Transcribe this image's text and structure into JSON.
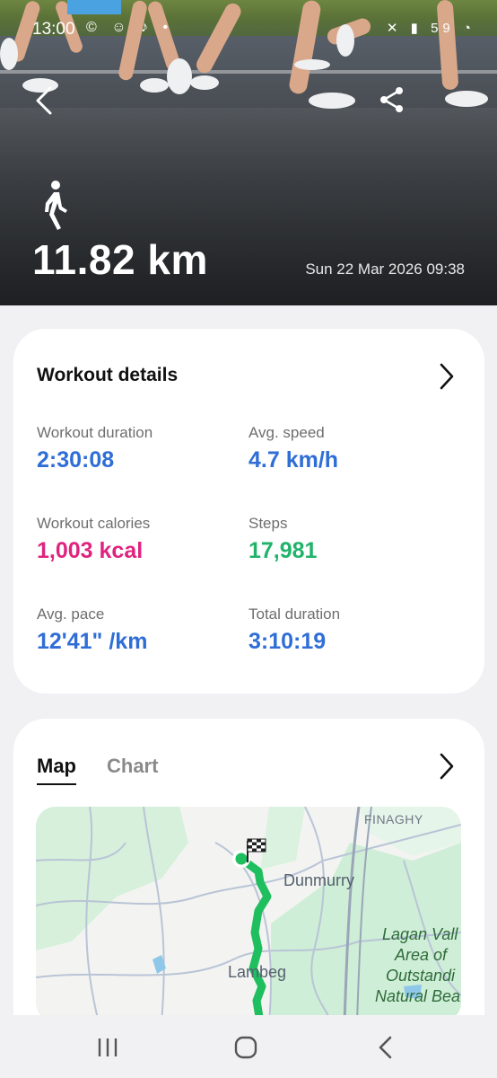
{
  "status_bar": {
    "time": "13:00",
    "left_icons": "© ☺ ♪ •",
    "right_icons": "✕ ▮ 59 ◔"
  },
  "hero": {
    "activity_icon": "walking-person-icon",
    "distance": "11.82 km",
    "datetime": "Sun 22 Mar 2026 09:38"
  },
  "workout_details": {
    "title": "Workout details",
    "metrics": [
      {
        "label": "Workout duration",
        "value": "2:30:08",
        "color": "#2f6ed6"
      },
      {
        "label": "Avg. speed",
        "value": "4.7 km/h",
        "color": "#2f6ed6"
      },
      {
        "label": "Workout calories",
        "value": "1,003 kcal",
        "color": "#e0237f"
      },
      {
        "label": "Steps",
        "value": "17,981",
        "color": "#21b36a"
      },
      {
        "label": "Avg. pace",
        "value": "12'41\" /km",
        "color": "#2f6ed6"
      },
      {
        "label": "Total duration",
        "value": "3:10:19",
        "color": "#2f6ed6"
      }
    ]
  },
  "map_card": {
    "tabs": [
      "Map",
      "Chart"
    ],
    "active_tab": "Map",
    "places": [
      "FINAGHY",
      "Dunmurry",
      "Lambeg",
      "Lagan Vall",
      "Area of",
      "Outstandi",
      "Natural Bea"
    ],
    "route_color": "#1fbf5f"
  },
  "nav": {
    "recents": "recent-apps-icon",
    "home": "home-icon",
    "back": "back-icon"
  }
}
